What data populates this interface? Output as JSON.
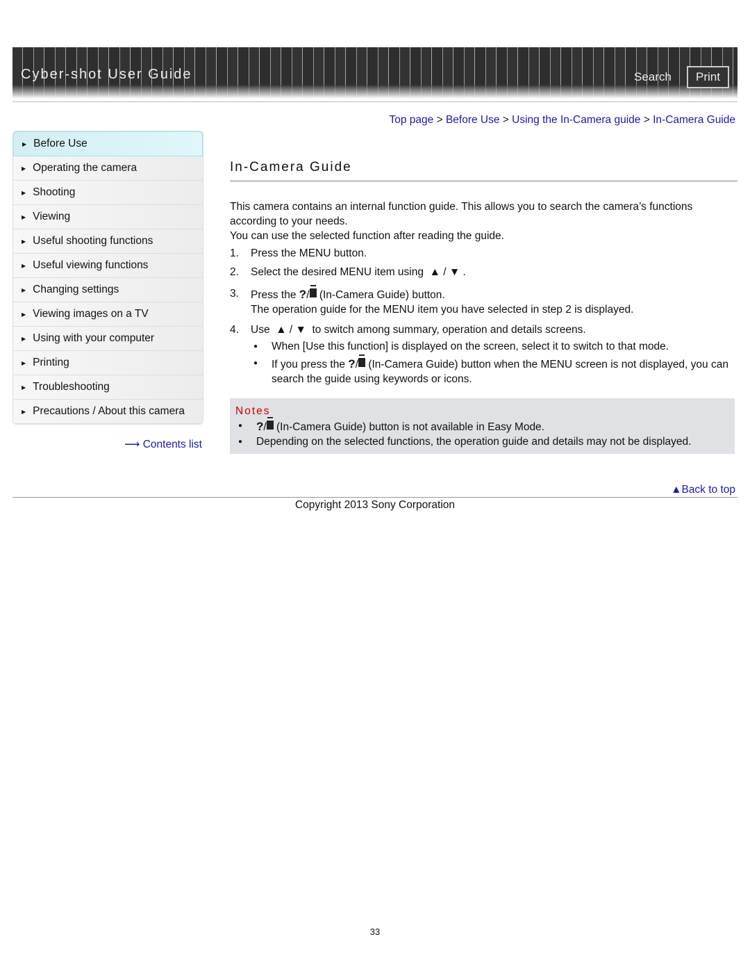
{
  "header": {
    "title": "Cyber-shot User Guide",
    "search": "Search",
    "print": "Print"
  },
  "breadcrumb": [
    "Top page",
    "Before Use",
    "Using the In-Camera guide",
    "In-Camera Guide"
  ],
  "breadcrumb_sep": ">",
  "sidebar": {
    "items": [
      "Before Use",
      "Operating the camera",
      "Shooting",
      "Viewing",
      "Useful shooting functions",
      "Useful viewing functions",
      "Changing settings",
      "Viewing images on a TV",
      "Using with your computer",
      "Printing",
      "Troubleshooting",
      "Precautions / About this camera"
    ],
    "selected": "Before Use",
    "contents_list": "Contents list"
  },
  "page_title": "In-Camera Guide",
  "intro": [
    "This camera contains an internal function guide. This allows you to search the camera’s functions according to your needs.",
    "You can use the selected function after reading the guide."
  ],
  "steps": [
    {
      "num": "1.",
      "text": "Press the MENU button."
    },
    {
      "num": "2.",
      "before": "Select the desired MENU item using",
      "after": "."
    },
    {
      "num": "3.",
      "before": "Press the",
      "after": "(In-Camera Guide) button.",
      "detail": "The operation guide for the MENU item you have selected in step 2 is displayed."
    },
    {
      "num": "4.",
      "before": "Use",
      "after": "to switch among summary, operation and details screens.",
      "bullets": [
        {
          "text": "When [Use this function] is displayed on the screen, select it to switch to that mode."
        },
        {
          "before": "If you press the",
          "after": "(In-Camera Guide) button when the MENU screen is not displayed, you can search the guide using keywords or icons."
        }
      ]
    }
  ],
  "notes": {
    "heading": "Notes",
    "items": [
      {
        "after": "(In-Camera Guide) button is not available in Easy Mode."
      },
      {
        "text": "Depending on the selected functions, the operation guide and details may not be displayed."
      }
    ]
  },
  "back_to_top": "Back to top",
  "copyright": "Copyright 2013 Sony Corporation",
  "page_number": "33",
  "colors": {
    "link": "#1a1aa8",
    "notes_heading": "#cc0000",
    "notes_bg": "#dfe1e5"
  }
}
